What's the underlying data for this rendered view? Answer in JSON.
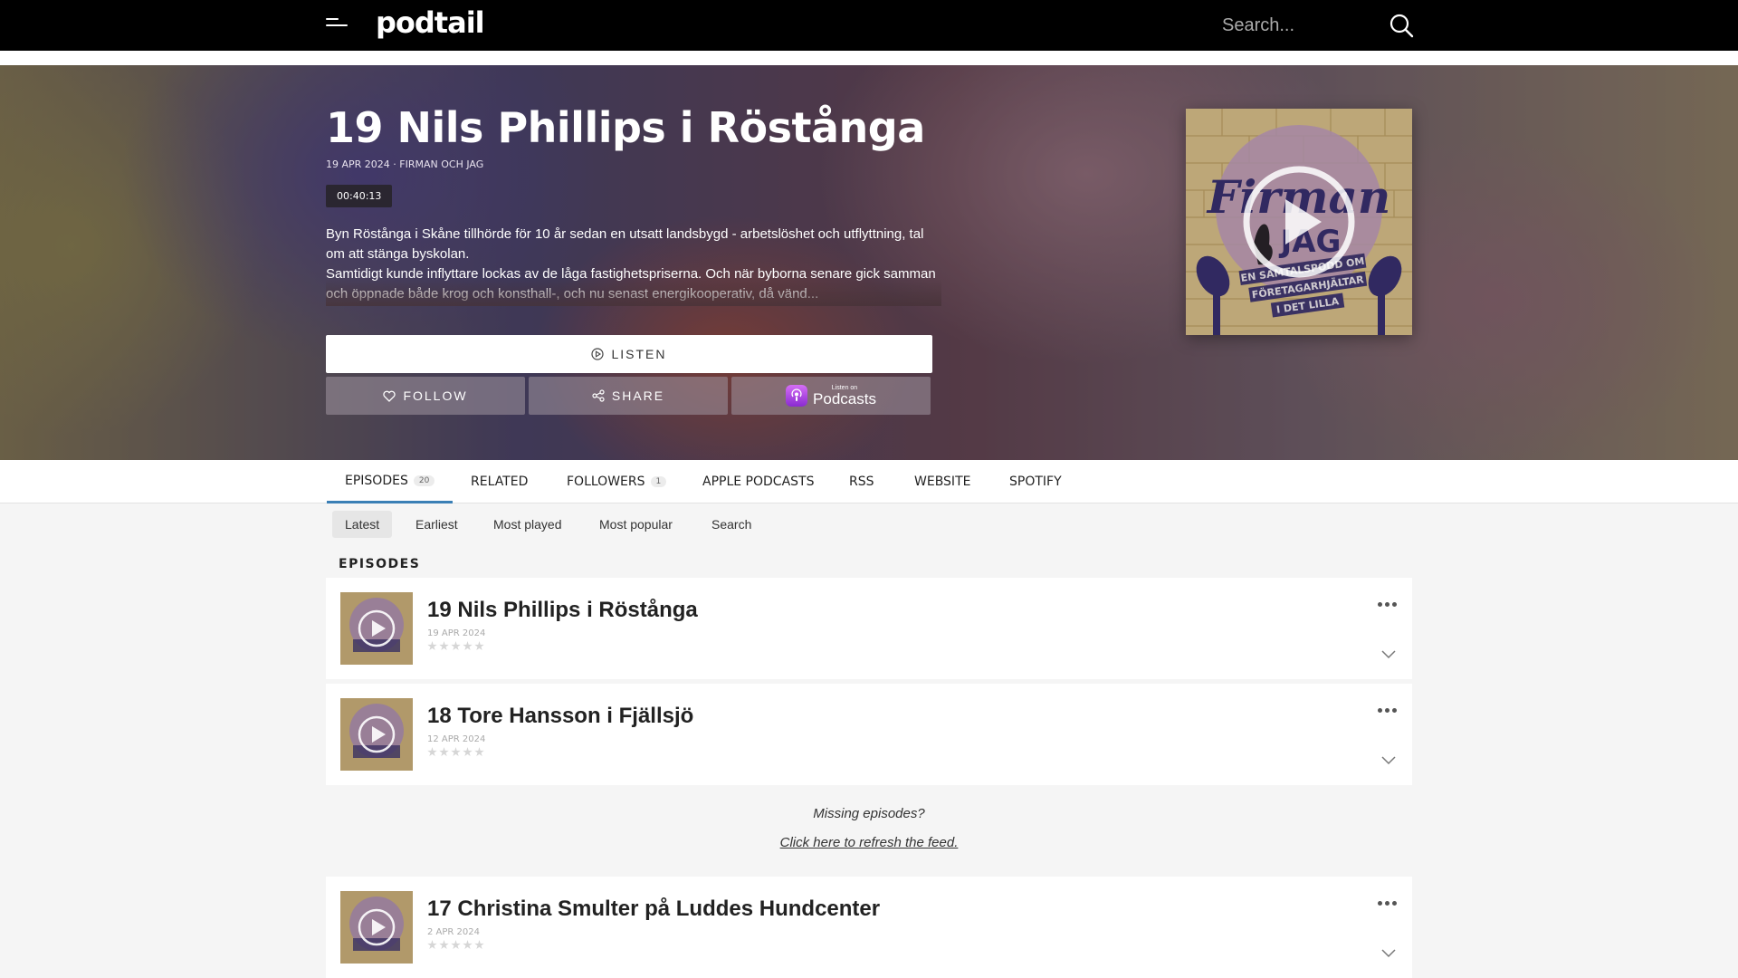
{
  "header": {
    "logo": "podtail",
    "search_placeholder": "Search..."
  },
  "episode": {
    "title": "19 Nils Phillips i Röstånga",
    "meta": "19 APR 2024 · FIRMAN OCH JAG",
    "duration": "00:40:13",
    "description_1": "Byn Röstånga i Skåne tillhörde för 10 år sedan en utsatt landsbygd - arbetslöshet och utflyttning, tal om att stänga byskolan.",
    "description_2": "Samtidigt kunde inflyttare lockas av de låga fastighetspriserna. Och när byborna senare gick samman och öppnade både krog och konsthall-, och nu senast energikooperativ, då vänd..."
  },
  "buttons": {
    "listen": "LISTEN",
    "follow": "FOLLOW",
    "share": "SHARE",
    "apple_small": "Listen on",
    "apple_big": "Podcasts"
  },
  "cover": {
    "line1": "EN SAMTALSPODD OM",
    "line2": "FÖRETAGARHJÄLTAR",
    "line3": "I DET LILLA",
    "brand": "Firman",
    "brand2": "JAG"
  },
  "tabs": [
    {
      "label": "EPISODES",
      "count": "20"
    },
    {
      "label": "RELATED"
    },
    {
      "label": "FOLLOWERS",
      "count": "1"
    },
    {
      "label": "APPLE PODCASTS"
    },
    {
      "label": "RSS"
    },
    {
      "label": "WEBSITE"
    },
    {
      "label": "SPOTIFY"
    }
  ],
  "filters": [
    "Latest",
    "Earliest",
    "Most played",
    "Most popular",
    "Search"
  ],
  "section_label": "EPISODES",
  "episodes": [
    {
      "title": "19 Nils Phillips i Röstånga",
      "date": "19 APR 2024"
    },
    {
      "title": "18 Tore Hansson i Fjällsjö",
      "date": "12 APR 2024"
    },
    {
      "title": "17 Christina Smulter på Luddes Hundcenter",
      "date": "2 APR 2024"
    }
  ],
  "missing": {
    "question": "Missing episodes?",
    "link": "Click here to refresh the feed."
  },
  "colors": {
    "topbar": "#000000",
    "active_tab_underline": "#3a7fb5",
    "apple_podcasts": "#a43fe0"
  }
}
